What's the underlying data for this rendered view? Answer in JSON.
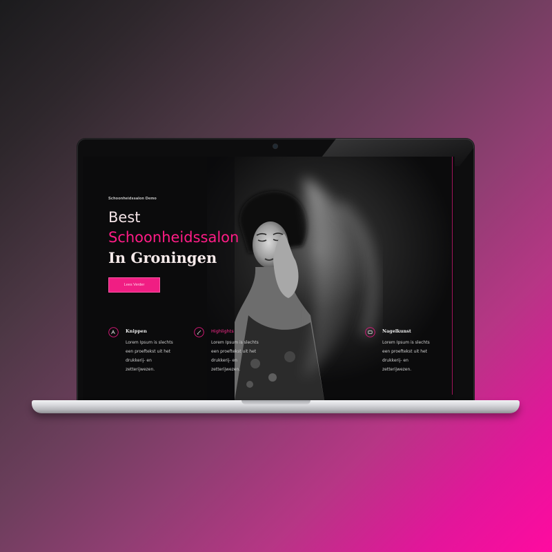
{
  "screen": {
    "brand": "Schoonheidssalon Demo",
    "hero": {
      "line1": "Best",
      "line2": "Schoonheidssalon",
      "line3": "In Groningen"
    },
    "cta_label": "Lees Verder",
    "features": [
      {
        "title": "Knippen",
        "text": "Lorem Ipsum is slechts een proeftekst uit het drukkerij- en zetterijwezen.",
        "icon": "hair-icon"
      },
      {
        "title": "Highlights",
        "text": "Lorem Ipsum is slechts een proeftekst uit het drukkerij- en zetterijwezen.",
        "icon": "brush-icon"
      },
      {
        "title": "Nagelkunst",
        "text": "Lorem Ipsum is slechts een proeftekst uit het drukkerij- en zetterijwezen.",
        "icon": "nail-icon"
      }
    ]
  },
  "colors": {
    "accent": "#ff1c86",
    "screen_bg": "#0b0b0c",
    "background_start": "#1b1b1d",
    "background_end": "#ff0aa0"
  }
}
